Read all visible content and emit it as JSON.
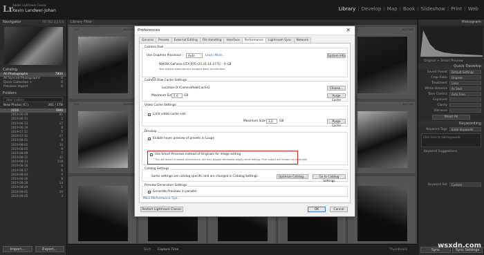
{
  "identity": {
    "subtitle": "Adobe Lightroom Classic",
    "name": "Kevin Landwer-Johan"
  },
  "modules": [
    "Library",
    "Develop",
    "Map",
    "Book",
    "Slideshow",
    "Print",
    "Web"
  ],
  "active_module": "Library",
  "left_panel": {
    "navigator_title": "Navigator",
    "navigator_options": "FIT  FILL  1:1  1:4",
    "catalog_title": "Catalog",
    "catalog_items": [
      {
        "label": "All Photographs",
        "count": "7800"
      },
      {
        "label": "All Synced Photographs",
        "count": "0"
      },
      {
        "label": "Quick Collection +",
        "count": "0"
      },
      {
        "label": "Previous Import",
        "count": "0"
      }
    ],
    "folders_title": "Folders",
    "filter_placeholder": "Filter Folders",
    "volume": {
      "label": "New Photos (C:)",
      "count": "361 / 1TB"
    },
    "folders": [
      {
        "label": "2019",
        "count": "7800"
      },
      {
        "label": "2019-06-09",
        "count": "81"
      },
      {
        "label": "2019-06-11",
        "count": "2"
      },
      {
        "label": "2019-06-13",
        "count": "17"
      },
      {
        "label": "2019-06-19",
        "count": "8"
      },
      {
        "label": "2019-07-11",
        "count": "5"
      },
      {
        "label": "2019-07-31",
        "count": "17"
      },
      {
        "label": "2019-08-01",
        "count": "4"
      },
      {
        "label": "2019-08-02",
        "count": "35"
      },
      {
        "label": "2019-08-05",
        "count": "9"
      },
      {
        "label": "2019-08-09",
        "count": "7"
      },
      {
        "label": "2019-08-11",
        "count": "32"
      },
      {
        "label": "2019-08-13",
        "count": "118"
      },
      {
        "label": "2019-08-16",
        "count": "4"
      },
      {
        "label": "2019-08-17",
        "count": "6"
      },
      {
        "label": "2019-08-24",
        "count": "9"
      },
      {
        "label": "2019-08-26",
        "count": "8"
      },
      {
        "label": "2019-08-28",
        "count": "14"
      },
      {
        "label": "2019-08-29",
        "count": "1"
      },
      {
        "label": "2019-09-01",
        "count": "10"
      },
      {
        "label": "2019-09-05",
        "count": "3"
      }
    ],
    "import_button": "Import...",
    "export_button": "Export..."
  },
  "center": {
    "library_filter": "Library Filter :",
    "cells": [
      {
        "index": "889",
        "file": "_KLS7153"
      },
      {
        "index": "890",
        "file": "_KLS7154"
      },
      {
        "index": "891",
        "file": "_KLS7155"
      },
      {
        "index": "892",
        "file": "_KLS7156"
      },
      {
        "index": "896",
        "file": "_KLS7160"
      },
      {
        "index": "897",
        "file": "_KLS7161"
      },
      {
        "index": "898",
        "file": "_KLS7162"
      },
      {
        "index": "899",
        "file": "_KLS7163"
      }
    ],
    "toolbar": {
      "sort_label": "Sort:",
      "sort_value": "Capture Time",
      "thumbnails_label": "Thumbnails"
    }
  },
  "right_panel": {
    "histogram_title": "Histogram",
    "preview_label": "Original + Smart Preview",
    "quick_develop_title": "Quick Develop",
    "rows": [
      {
        "label": "Saved Preset",
        "value": "Default Settings"
      },
      {
        "label": "Crop Ratio",
        "value": "Original"
      },
      {
        "label": "Treatment",
        "value": "Color"
      },
      {
        "label": "White Balance",
        "value": "As Shot"
      },
      {
        "label": "Tone Control",
        "value": "Auto Tone"
      },
      {
        "label": "Exposure",
        "value": ""
      },
      {
        "label": "Clarity",
        "value": ""
      },
      {
        "label": "Vibrance",
        "value": ""
      }
    ],
    "reset_all": "Reset All",
    "keywording_title": "Keywording",
    "keyword_tags_label": "Keyword Tags",
    "keyword_tags_value": "Enter Keywords",
    "click_keywords": "Click here to add keywords",
    "keyword_suggestions": "Keyword Suggestions",
    "keyword_set_label": "Keyword Set",
    "keyword_set_value": "Custom",
    "sync_button": "Sync",
    "sync_settings": "Sync Settings",
    "watermark": "wsxdn.com"
  },
  "dialog": {
    "title": "Preferences",
    "close_glyph": "✕",
    "tabs": [
      "General",
      "Presets",
      "External Editing",
      "File Handling",
      "Interface",
      "Performance",
      "Lightroom Sync",
      "Network"
    ],
    "active_tab": "Performance",
    "camera_raw": {
      "title": "Camera Raw",
      "gpu_label": "Use Graphics Processor :",
      "gpu_value": "Auto",
      "learn_more": "Learn More...",
      "system_info": "System Info",
      "gpu_name": "NVIDIA GeForce GTX 970 (25.21.14.1771) - 4 GB",
      "gpu_note": "Your system automatically supports basic acceleration."
    },
    "cache": {
      "title": "Camera Raw Cache Settings",
      "location_label": "Location:",
      "location_value": "D:\\CameraRaw\\Cache2",
      "choose_button": "Choose...",
      "max_size_label": "Maximum Size:",
      "max_size_value": "5.0",
      "unit": "GB",
      "purge_button": "Purge Cache"
    },
    "video_cache": {
      "title": "Video Cache Settings",
      "limit_label": "Limit video cache size",
      "max_size_label": "Maximum Size:",
      "max_size_value": "3.0",
      "unit": "GB",
      "purge_button": "Purge Cache"
    },
    "develop": {
      "title": "Develop",
      "hover_preview": "Enable hover preview of presets in Loupe",
      "smart_previews": "Use Smart Previews instead of Originals for image editing",
      "smart_previews_note": "This will allow increased performance, but may display decreased quality while editing. Final output will remain full resolution."
    },
    "catalog": {
      "title": "Catalog Settings",
      "note": "Some settings are catalog specific and are changed in Catalog Settings.",
      "optimize_button": "Optimize Catalog...",
      "goto_button": "Go to Catalog Settings"
    },
    "preview_gen": {
      "title": "Preview Generation Settings",
      "parallel": "Generate Previews in parallel"
    },
    "more_tips": "More Performance Tips...",
    "restart_button": "Restart Lightroom Classic",
    "ok_button": "OK",
    "cancel_button": "Cancel"
  }
}
